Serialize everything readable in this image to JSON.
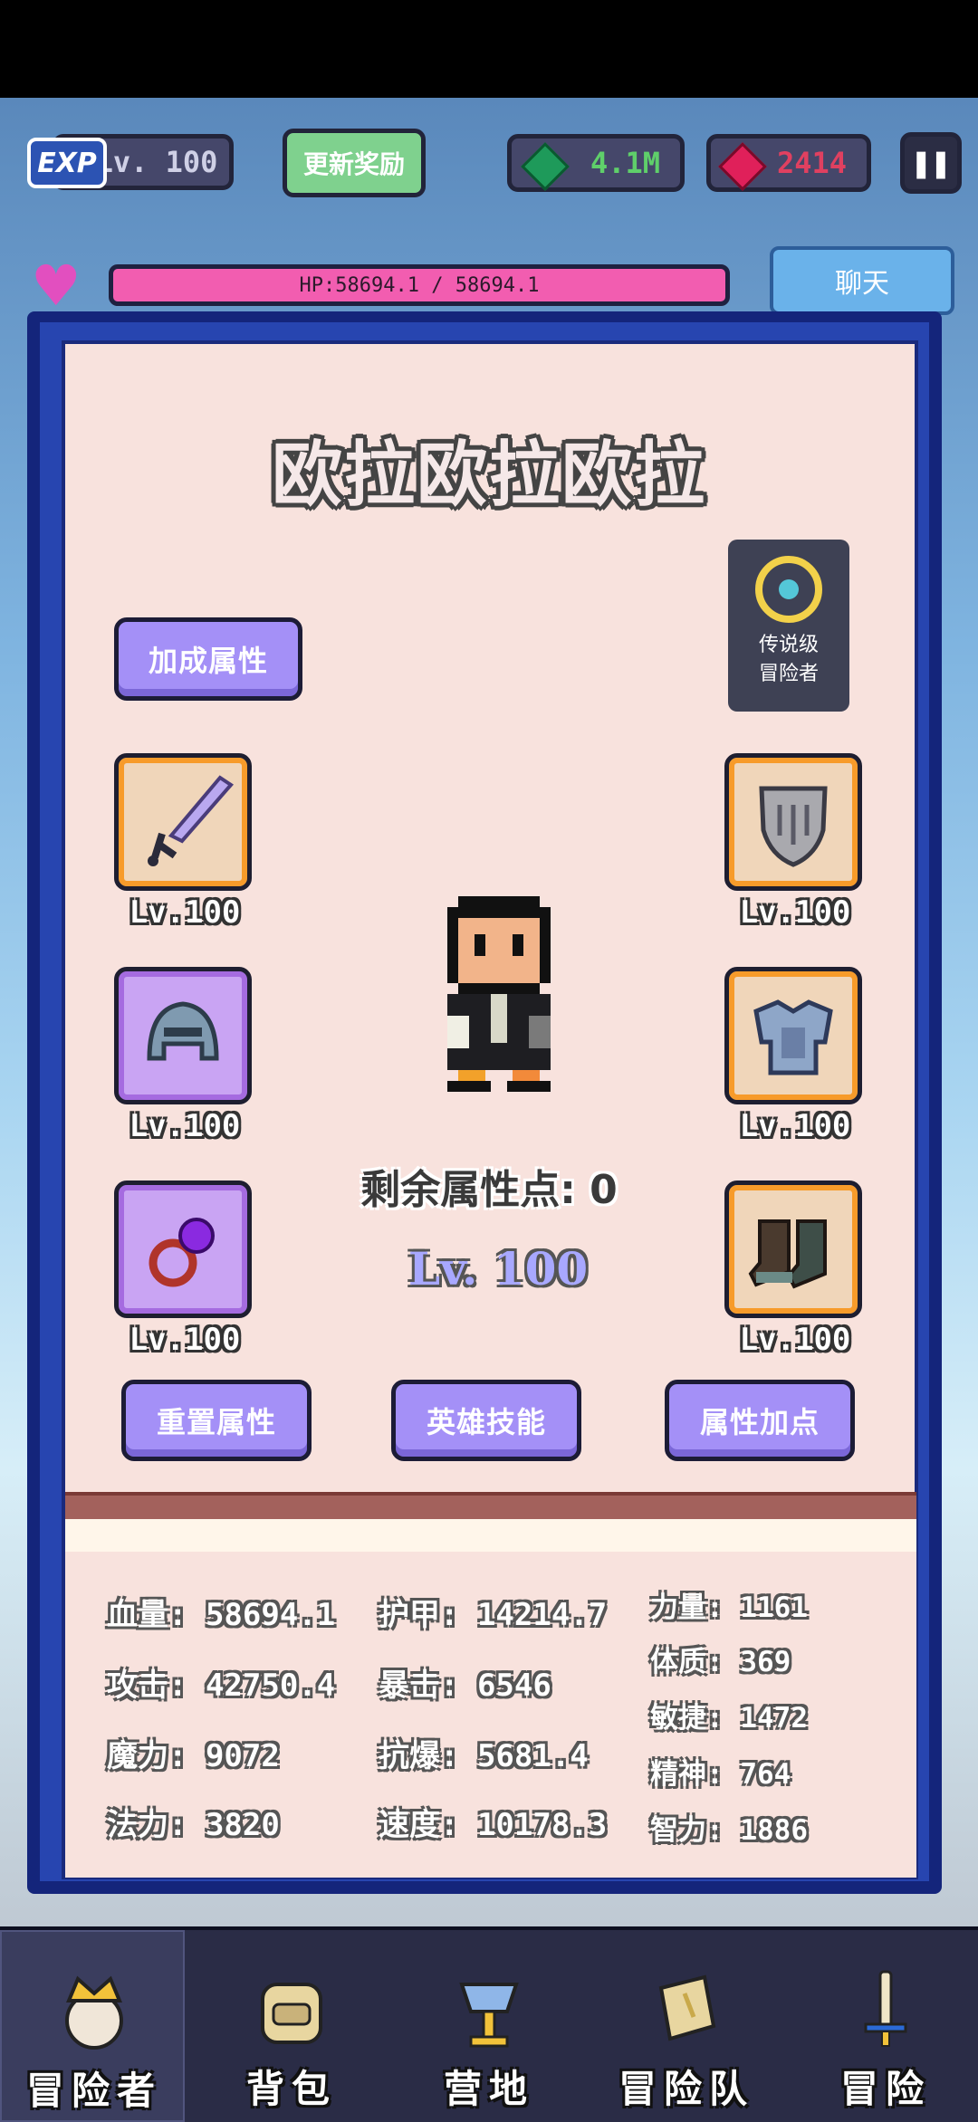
{
  "hud": {
    "exp_badge": "EXP",
    "level": "Lv. 100",
    "reward_button": "更新奖励",
    "gems": "4.1M",
    "rubies": "2414",
    "pause_icon": "pause-icon",
    "hp_text": "HP:58694.1 / 58694.1",
    "chat_button": "聊天"
  },
  "panel": {
    "hero_name": "欧拉欧拉欧拉",
    "legend_badge": [
      "传说级",
      "冒险者"
    ],
    "bonus_button": "加成属性",
    "remaining_points": "剩余属性点: 0",
    "hero_level": "Lv. 100",
    "equipment": [
      {
        "slot": "weapon",
        "icon": "sword-icon",
        "level": "Lv.100",
        "rarity": "orange"
      },
      {
        "slot": "helmet",
        "icon": "helmet-icon",
        "level": "Lv.100",
        "rarity": "purple"
      },
      {
        "slot": "ring",
        "icon": "ring-icon",
        "level": "Lv.100",
        "rarity": "purple"
      },
      {
        "slot": "shield",
        "icon": "shield-icon",
        "level": "Lv.100",
        "rarity": "orange"
      },
      {
        "slot": "armor",
        "icon": "armor-icon",
        "level": "Lv.100",
        "rarity": "orange"
      },
      {
        "slot": "boots",
        "icon": "boots-icon",
        "level": "Lv.100",
        "rarity": "orange"
      }
    ],
    "buttons": {
      "reset": "重置属性",
      "skills": "英雄技能",
      "add_points": "属性加点"
    },
    "stats": {
      "hp": "血量: 58694.1",
      "armor": "护甲: 14214.7",
      "strength": "力量: 1161",
      "attack": "攻击: 42750.4",
      "crit": "暴击: 6546",
      "constitution": "体质: 369",
      "magic": "魔力: 9072",
      "crit_resist": "抗爆: 5681.4",
      "agility": "敏捷: 1472",
      "mana": "法力: 3820",
      "speed": "速度: 10178.3",
      "spirit": "精神: 764",
      "intelligence": "智力: 1886"
    }
  },
  "nav": [
    {
      "label": "冒险者",
      "icon": "crown-icon"
    },
    {
      "label": "背包",
      "icon": "backpack-icon"
    },
    {
      "label": "营地",
      "icon": "camp-icon"
    },
    {
      "label": "冒险队",
      "icon": "book-icon"
    },
    {
      "label": "冒险",
      "icon": "sword-icon"
    }
  ],
  "colors": {
    "panel_bg": "#f8e2dd",
    "panel_border": "#2745b0",
    "button_purple": "#a490f7",
    "hp_pink": "#f25db0"
  }
}
